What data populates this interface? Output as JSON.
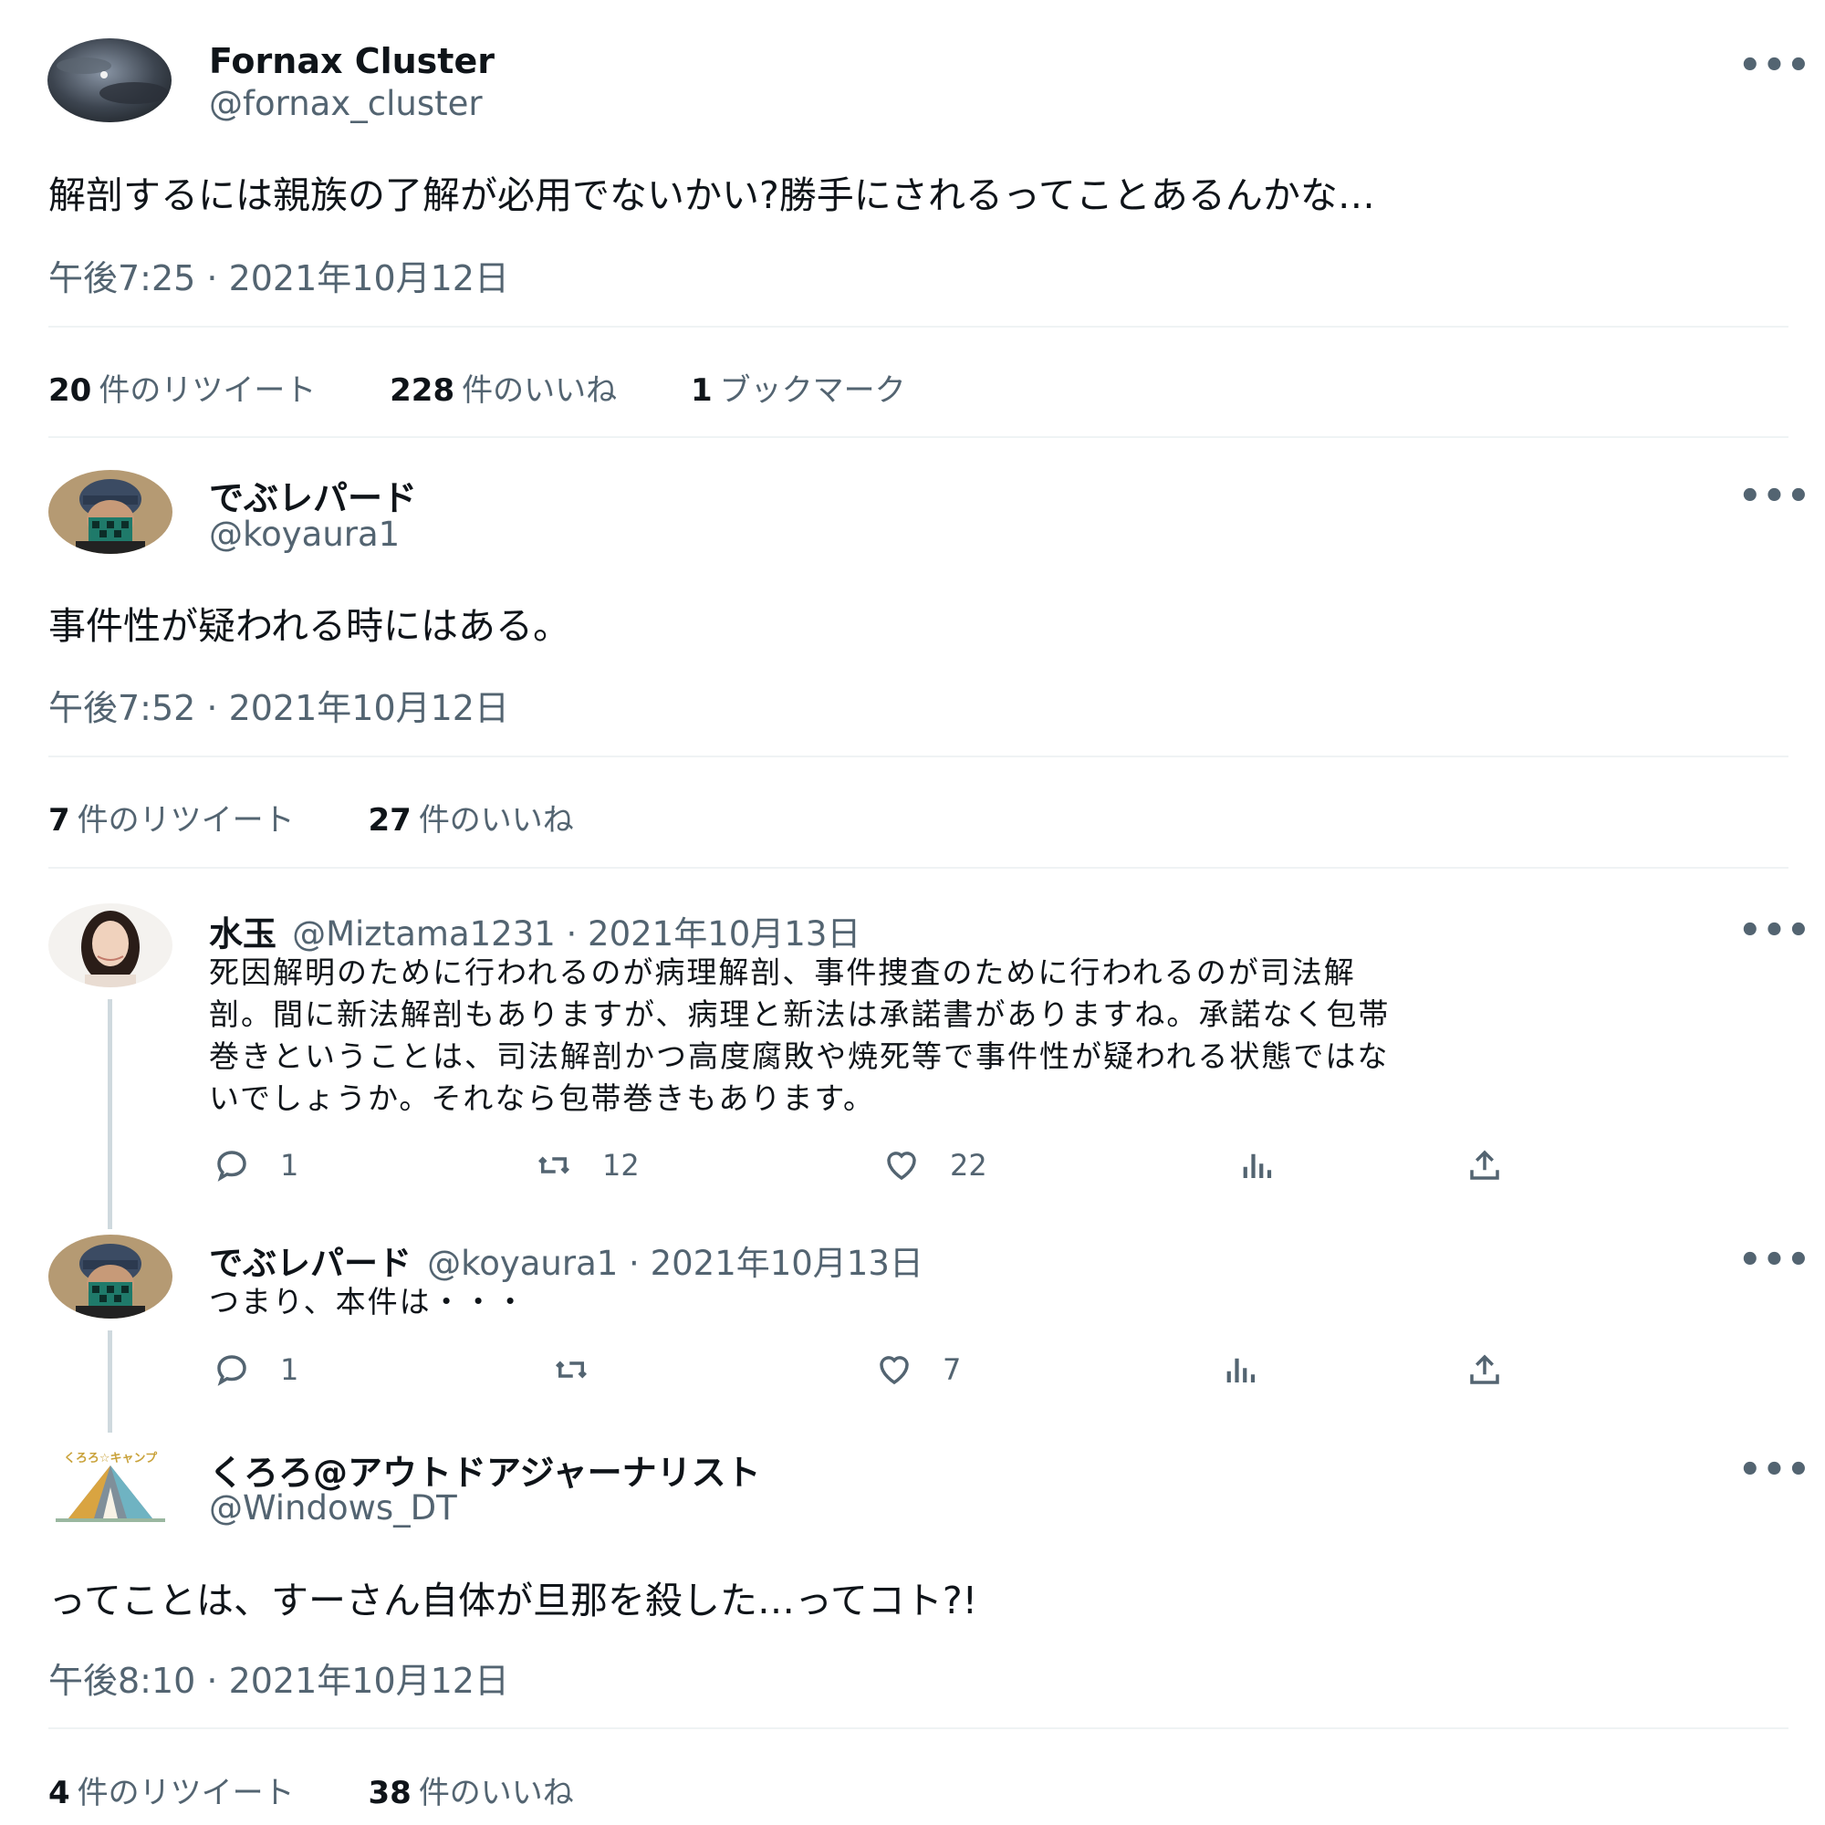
{
  "tweets": [
    {
      "name": "Fornax Cluster",
      "handle": "@fornax_cluster",
      "text": "解剖するには親族の了解が必用でないかい?勝手にされるってことあるんかな…",
      "time": "午後7:25 · 2021年10月12日",
      "retweets_num": "20",
      "retweets_label": "件のリツイート",
      "likes_num": "228",
      "likes_label": "件のいいね",
      "bookmarks_num": "1",
      "bookmarks_label": "ブックマーク"
    },
    {
      "name": "でぶレパード",
      "handle": "@koyaura1",
      "text": "事件性が疑われる時にはある。",
      "time": "午後7:52 · 2021年10月12日",
      "retweets_num": "7",
      "retweets_label": "件のリツイート",
      "likes_num": "27",
      "likes_label": "件のいいね"
    },
    {
      "name": "くろろ@アウトドアジャーナリスト",
      "handle": "@Windows_DT",
      "text": "ってことは、すーさん自体が旦那を殺した…ってコト?!",
      "time": "午後8:10 · 2021年10月12日",
      "retweets_num": "4",
      "retweets_label": "件のリツイート",
      "likes_num": "38",
      "likes_label": "件のいいね"
    }
  ],
  "replies": [
    {
      "name": "水玉",
      "meta": "@Miztama1231 · 2021年10月13日",
      "lines": [
        "死因解明のために行われるのが病理解剖、事件捜査のために行われるのが司法解",
        "剖。間に新法解剖もありますが、病理と新法は承諾書がありますね。承諾なく包帯",
        "巻きということは、司法解剖かつ高度腐敗や焼死等で事件性が疑われる状態ではな",
        "いでしょうか。それなら包帯巻きもあります。"
      ],
      "reply_count": "1",
      "retweet_count": "12",
      "like_count": "22"
    },
    {
      "name": "でぶレパード",
      "meta": "@koyaura1 · 2021年10月13日",
      "lines": [
        "つまり、本件は・・・"
      ],
      "reply_count": "1",
      "retweet_count": "",
      "like_count": "7"
    }
  ],
  "more_label": "•••",
  "avatar_text": "くろろ☆キャンプ",
  "colors": {
    "text": "#0f1419",
    "secondary": "#536471",
    "divider": "#eff3f4"
  },
  "icons": [
    "reply-icon",
    "retweet-icon",
    "like-icon",
    "analytics-icon",
    "share-icon",
    "more-icon"
  ]
}
